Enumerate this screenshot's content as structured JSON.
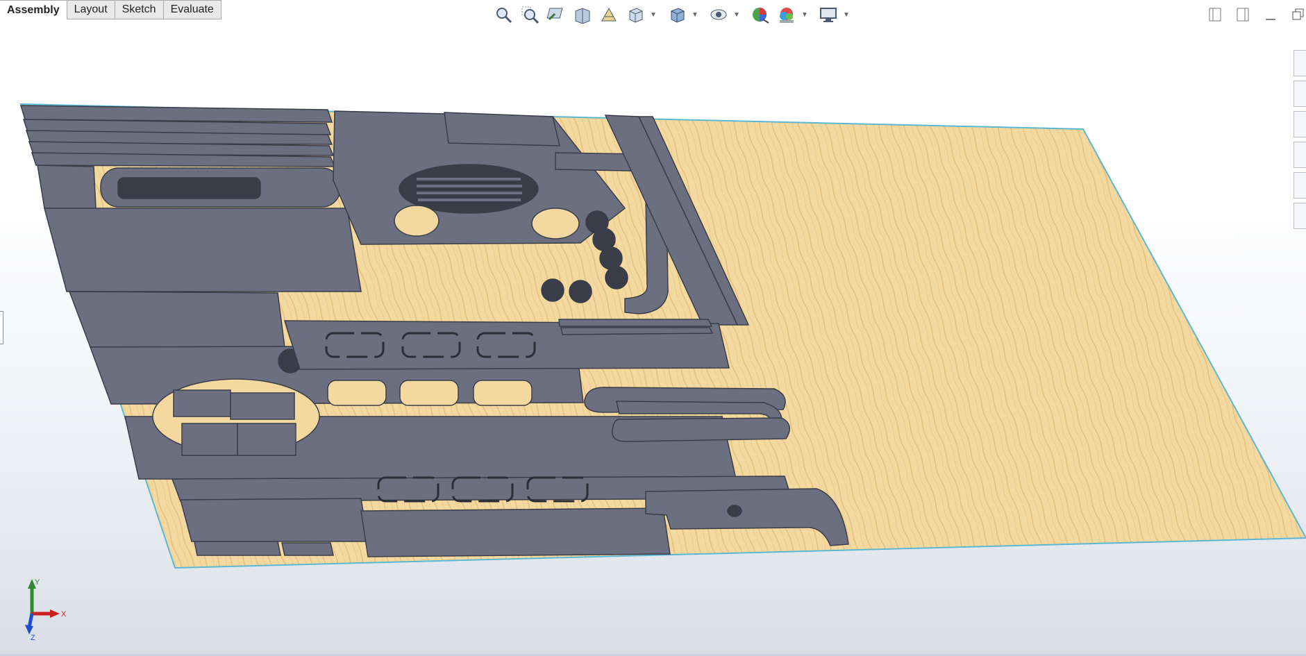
{
  "tabs": [
    {
      "label": "Assembly",
      "active": true
    },
    {
      "label": "Layout",
      "active": false
    },
    {
      "label": "Sketch",
      "active": false
    },
    {
      "label": "Evaluate",
      "active": false
    }
  ],
  "hud_tools": [
    {
      "name": "zoom-to-fit-icon"
    },
    {
      "name": "zoom-to-area-icon"
    },
    {
      "name": "previous-view-icon"
    },
    {
      "name": "section-view-icon"
    },
    {
      "name": "dynamic-annotation-icon"
    },
    {
      "name": "view-orientation-icon",
      "dropdown": true
    },
    {
      "name": "display-style-icon",
      "dropdown": true
    },
    {
      "name": "hide-show-items-icon",
      "dropdown": true
    },
    {
      "name": "edit-appearance-icon"
    },
    {
      "name": "apply-scene-icon",
      "dropdown": true
    },
    {
      "name": "view-settings-icon",
      "dropdown": true
    }
  ],
  "window_controls": [
    "tile-left-icon",
    "tile-right-icon",
    "minimize-icon",
    "restore-icon"
  ],
  "task_pane": [
    "resources-icon",
    "design-library-icon",
    "file-explorer-icon",
    "view-palette-icon",
    "appearances-icon",
    "custom-properties-icon"
  ],
  "triad": {
    "x": "X",
    "y": "Y",
    "z": "Z"
  },
  "colors": {
    "plate": "#6b6f80",
    "plate_edge": "#3a3d48",
    "wood": "#f3d9a0",
    "sheet_edge": "#5bb8d4",
    "axis_x": "#c8201a",
    "axis_y": "#2f8a2f",
    "axis_z": "#1f4fd0"
  }
}
